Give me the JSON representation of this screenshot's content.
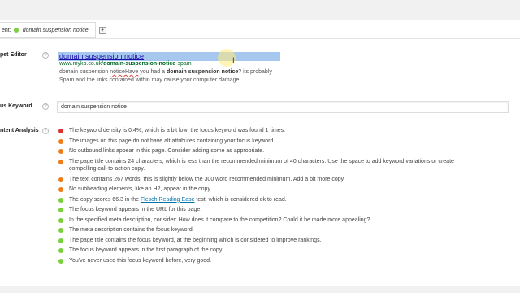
{
  "tab": {
    "label": "ent:",
    "keyword": "domain suspension notice",
    "add_label": "+",
    "status_color": "#7ad03a"
  },
  "snippet_editor": {
    "label": "pet Editor",
    "help": "?",
    "title": "domain suspension notice",
    "url_prefix": "www.mykp.co.uk/",
    "url_slug": "domain-suspension-notice",
    "url_suffix": "-spam",
    "desc_part1": "domain suspension ",
    "desc_squiggle": "noticeHave",
    "desc_part2": " you had a ",
    "desc_bold": "domain suspension notice",
    "desc_part3": "? its probably Spam and the links contained within may cause your computer damage."
  },
  "focus_keyword": {
    "label": "us Keyword",
    "help": "?",
    "value": "domain suspension notice"
  },
  "content_analysis": {
    "label": "ntent Analysis",
    "help": "?",
    "items": [
      {
        "color": "#dc3232",
        "text": "The keyword density is 0.4%, which is a bit low; the focus keyword was found 1 times."
      },
      {
        "color": "#ee7c1b",
        "text": "The images on this page do not have alt attributes containing your focus keyword."
      },
      {
        "color": "#ee7c1b",
        "text": "No outbound links appear in this page. Consider adding some as appropriate."
      },
      {
        "color": "#ee7c1b",
        "text": "The page title contains 24 characters, which is less than the recommended minimum of 40 characters. Use the space to add keyword variations or create compelling call-to-action copy."
      },
      {
        "color": "#ee7c1b",
        "text": "The text contains 267 words, this is slightly below the 300 word recommended minimum. Add a bit more copy."
      },
      {
        "color": "#ee7c1b",
        "text": "No subheading elements, like an H2, appear in the copy."
      },
      {
        "color": "#7ad03a",
        "text_pre": "The copy scores 66.3 in the ",
        "link": "Flesch Reading Ease",
        "text_post": " test, which is considered ok to read."
      },
      {
        "color": "#7ad03a",
        "text": "The focus keyword appears in the URL for this page."
      },
      {
        "color": "#7ad03a",
        "text": "In the specified meta description, consider: How does it compare to the competition? Could it be made more appealing?"
      },
      {
        "color": "#7ad03a",
        "text": "The meta description contains the focus keyword."
      },
      {
        "color": "#7ad03a",
        "text": "The page title contains the focus keyword, at the beginning which is considered to improve rankings."
      },
      {
        "color": "#7ad03a",
        "text": "The focus keyword appears in the first paragraph of the copy."
      },
      {
        "color": "#7ad03a",
        "text": "You've never used this focus keyword before, very good."
      }
    ]
  }
}
